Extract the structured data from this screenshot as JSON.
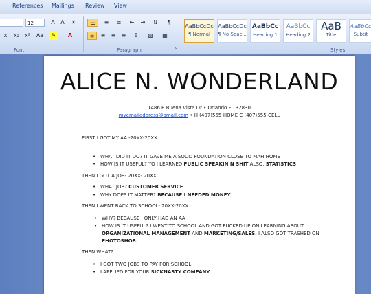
{
  "menu": [
    "References",
    "Mailings",
    "Review",
    "View"
  ],
  "font": {
    "size": "12",
    "group_label": "Font"
  },
  "paragraph": {
    "group_label": "Paragraph"
  },
  "styles": {
    "group_label": "Styles",
    "items": [
      {
        "preview": "AaBbCcDc",
        "name": "¶ Normal"
      },
      {
        "preview": "AaBbCcDc",
        "name": "¶ No Spaci..."
      },
      {
        "preview": "AaBbCc",
        "name": "Heading 1"
      },
      {
        "preview": "AaBbCc",
        "name": "Heading 2"
      },
      {
        "preview": "AaB",
        "name": "Title"
      },
      {
        "preview": "AaBbCc",
        "name": "Subtit"
      }
    ]
  },
  "document": {
    "title": "ALICE N. WONDERLAND",
    "address": "1486 E Buena Vista Dr  •  Orlando FL 32830",
    "email": "myemailaddress@gmail.com",
    "phones": " • H (407)555-HOME C (407)555-CELL",
    "sections": [
      {
        "heading": "FIRST I GOT MY AA -20XX-20XX"
      },
      {
        "heading": "THEN I GOT A JOB- 20XX- 20XX"
      },
      {
        "heading": "THEN I WENT BACK TO SCHOOL- 20XX-20XX"
      },
      {
        "heading": "THEN WHAT?"
      }
    ],
    "bullets": {
      "b1": "WHAT DID IT DO? IT GAVE ME A SOLID FOUNDATION CLOSE TO MAH HOME",
      "b2a": "HOW IS IT USEFUL? YO I LEARNED ",
      "b2b": "PUBLIC SPEAKIN N SHIT",
      "b2c": " ALSO, ",
      "b2d": "STATISTICS",
      "b3a": "WHAT JOB? ",
      "b3b": "CUSTOMER SERVICE",
      "b4a": "WHY DOES IT MATTER? ",
      "b4b": "BECAUSE I NEEDED  MONEY",
      "b5": "WHY? BECAUSE  I ONLY HAD AN AA",
      "b6a": "HOW IS IT USEFUL? I WENT TO SCHOOL AND GOT FUCKED UP ON LEARNING ABOUT",
      "b6b": "ORGANIZATIONAL MANAGEMENT",
      "b6c": " AND ",
      "b6d": "MARKETING/SALES.",
      "b6e": " I ALSO GOT TRASHED ON",
      "b6f": "PHOTOSHOP.",
      "b7": "I GOT TWO JOBS TO PAY FOR SCHOOL.",
      "b8a": "I APPLIED FOR YOUR ",
      "b8b": "SICKNASTY COMPANY"
    }
  },
  "colors": {
    "accent": "#15428b",
    "link": "#1a4ccf",
    "highlight": "#fbd46d"
  }
}
